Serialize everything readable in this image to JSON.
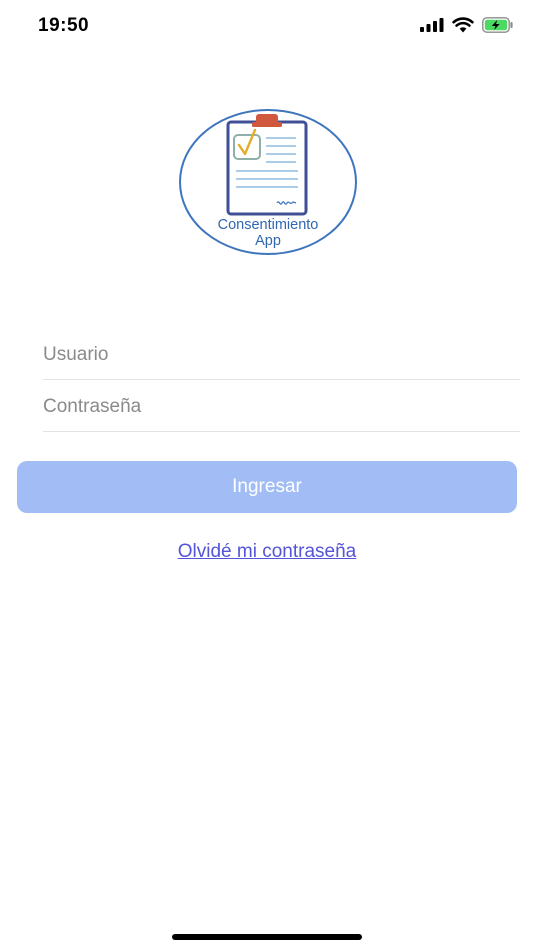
{
  "status_bar": {
    "time": "19:50",
    "signal_icon": "cellular-signal-icon",
    "wifi_icon": "wifi-icon",
    "battery_icon": "battery-charging-icon"
  },
  "logo": {
    "line1": "Consentimiento",
    "line2": "App"
  },
  "form": {
    "username_placeholder": "Usuario",
    "password_placeholder": "Contraseña",
    "login_label": "Ingresar",
    "forgot_label": "Olvidé mi contraseña"
  },
  "colors": {
    "button_bg": "#a2bdf5",
    "link": "#5454d9",
    "logo_ring": "#3e76bd",
    "battery_fill": "#4cd964"
  }
}
